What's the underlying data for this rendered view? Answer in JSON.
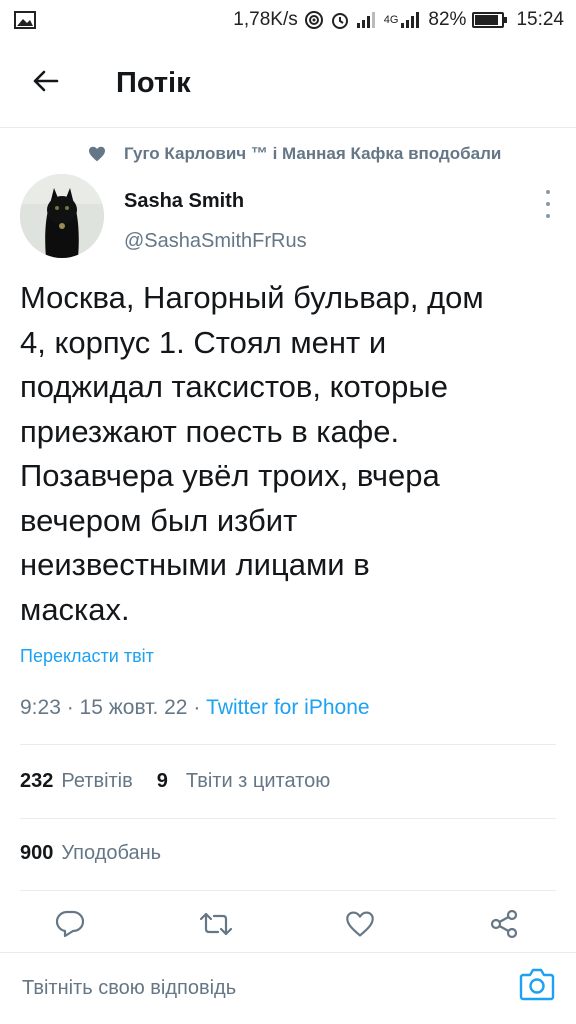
{
  "status_bar": {
    "speed": "1,78K/s",
    "network": "4G",
    "battery": "82%",
    "battery_level": 0.82,
    "time": "15:24"
  },
  "header": {
    "title": "Потік"
  },
  "tweet": {
    "social_context": "Гуго Карлович ™ і Манная Кафка вподобали",
    "author": {
      "name": "Sasha Smith",
      "handle": "@SashaSmithFrRus"
    },
    "text": "Москва, Нагорный бульвар, дом\n4, корпус 1. Стоял мент и\nподжидал таксистов, которые\nприезжают поесть в кафе.\nПозавчера увёл троих, вчера\nвечером был избит\nнеизвестными лицами в\nмасках.",
    "translate_label": "Перекласти твіт",
    "time": "9:23",
    "date": "15 жовт. 22",
    "source": "Twitter for iPhone",
    "retweets_count": "232",
    "retweets_label": "Ретвітів",
    "quotes_count": "9",
    "quotes_label": "Твіти з цитатою",
    "likes_count": "900",
    "likes_label": "Уподобань"
  },
  "reply": {
    "placeholder": "Твітніть свою відповідь"
  },
  "colors": {
    "accent": "#1da1f2",
    "secondary_text": "#657786",
    "primary_text": "#14171a",
    "divider": "#e6ecf0"
  },
  "icons": [
    "image-icon",
    "hotspot-icon",
    "alarm-icon",
    "signal-icon",
    "battery-icon",
    "back-arrow-icon",
    "heart-icon",
    "more-vertical-icon",
    "reply-icon",
    "retweet-icon",
    "like-icon",
    "share-icon",
    "camera-icon"
  ]
}
